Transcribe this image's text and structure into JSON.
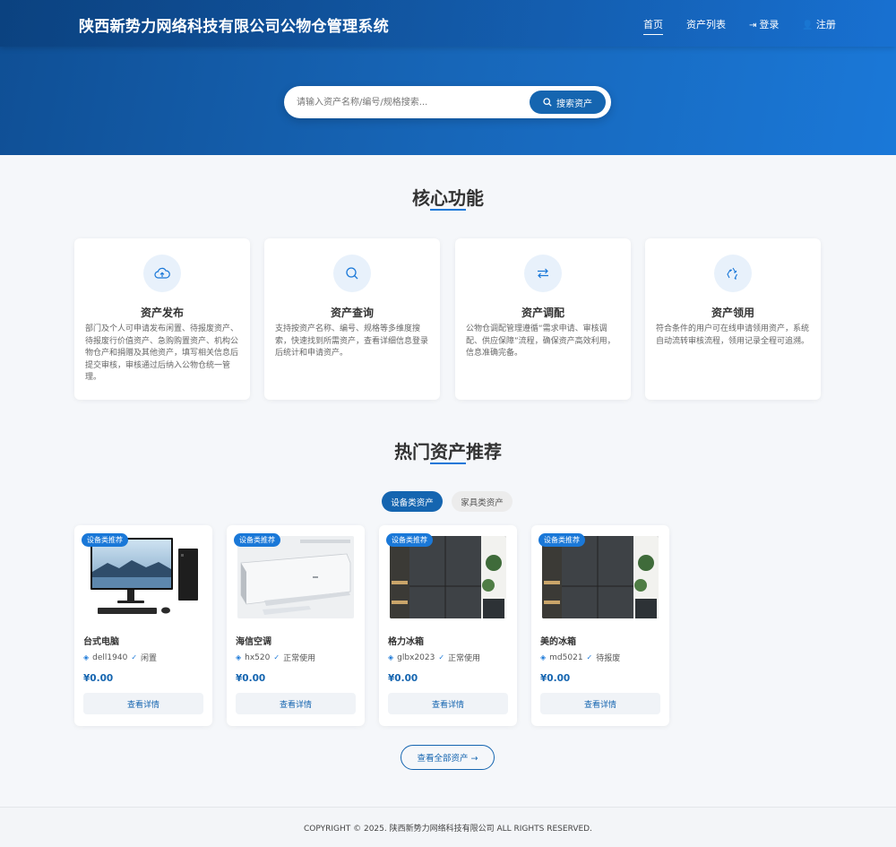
{
  "header": {
    "brand": "陕西新势力网络科技有限公司公物仓管理系统",
    "nav": [
      {
        "label": "首页",
        "icon": ""
      },
      {
        "label": "资产列表",
        "icon": ""
      },
      {
        "label": "登录",
        "icon": "login-icon"
      },
      {
        "label": "注册",
        "icon": "user-plus-icon"
      }
    ]
  },
  "search": {
    "placeholder": "请输入资产名称/编号/规格搜索...",
    "button_label": "搜索资产"
  },
  "features": {
    "title": "核心功能",
    "items": [
      {
        "icon": "cloud-upload-icon",
        "title": "资产发布",
        "desc": "部门及个人可申请发布闲置、待报废资产、待报废行价值资产、急购购置资产、机构公物仓产和捐赠及其他资产，填写相关信息后提交审核，审核通过后纳入公物仓统一管理。"
      },
      {
        "icon": "search-icon",
        "title": "资产查询",
        "desc": "支持按资产名称、编号、规格等多维度搜索，快速找到所需资产，查看详细信息登录后统计和申请资产。"
      },
      {
        "icon": "exchange-icon",
        "title": "资产调配",
        "desc": "公物仓调配管理遵循“需求申请、审核调配、供应保障”流程，确保资产高效利用，信息准确完备。"
      },
      {
        "icon": "recycle-icon",
        "title": "资产领用",
        "desc": "符合条件的用户可在线申请领用资产，系统自动流转审核流程，领用记录全程可追溯。"
      }
    ]
  },
  "hot": {
    "title": "热门资产推荐",
    "tabs": [
      "设备类资产",
      "家具类资产"
    ],
    "products": [
      {
        "badge": "设备类推荐",
        "name": "台式电脑",
        "code": "dell1940",
        "status": "闲置",
        "price": "¥0.00",
        "button": "查看详情"
      },
      {
        "badge": "设备类推荐",
        "name": "海信空调",
        "code": "hx520",
        "status": "正常使用",
        "price": "¥0.00",
        "button": "查看详情"
      },
      {
        "badge": "设备类推荐",
        "name": "格力冰箱",
        "code": "glbx2023",
        "status": "正常使用",
        "price": "¥0.00",
        "button": "查看详情"
      },
      {
        "badge": "设备类推荐",
        "name": "美的冰箱",
        "code": "md5021",
        "status": "待报废",
        "price": "¥0.00",
        "button": "查看详情"
      }
    ],
    "view_all": "查看全部资产 →"
  },
  "footer": {
    "copyright": "COPYRIGHT © 2025. 陕西新势力网络科技有限公司 ALL RIGHTS RESERVED."
  }
}
